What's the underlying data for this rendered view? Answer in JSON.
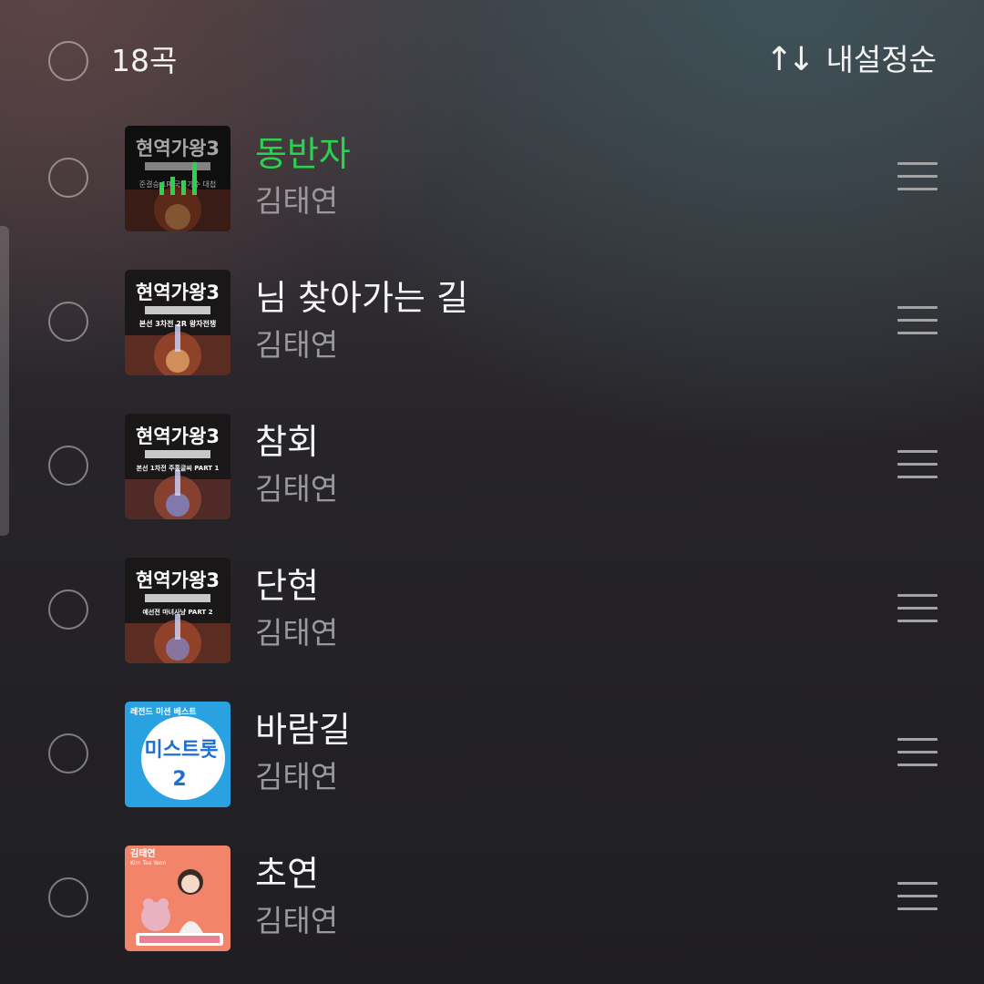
{
  "header": {
    "count_label": "18곡",
    "sort_icon": "↑↓",
    "sort_label": "내설정순"
  },
  "tracks": [
    {
      "title": "동반자",
      "artist": "김태연",
      "playing": true,
      "album_text": "현역가왕3",
      "album_sub": "준결승 1R 국민가수 대첩"
    },
    {
      "title": "님 찾아가는 길",
      "artist": "김태연",
      "playing": false,
      "album_text": "현역가왕3",
      "album_sub": "본선 3차전 2R 왕자전쟁"
    },
    {
      "title": "참회",
      "artist": "김태연",
      "playing": false,
      "album_text": "현역가왕3",
      "album_sub": "본선 1차전 주홍글씨 PART 1"
    },
    {
      "title": "단현",
      "artist": "김태연",
      "playing": false,
      "album_text": "현역가왕3",
      "album_sub": "예선전 마녀사냥 PART 2"
    },
    {
      "title": "바람길",
      "artist": "김태연",
      "playing": false,
      "album_text": "미스트롯",
      "album_sub": "레전드 미션 베스트"
    },
    {
      "title": "초연",
      "artist": "김태연",
      "playing": false,
      "album_text": "김태연",
      "album_sub": "Kim Tae Yeon"
    }
  ],
  "colors": {
    "playing": "#2bd24f",
    "artist": "#9a9a9e"
  }
}
